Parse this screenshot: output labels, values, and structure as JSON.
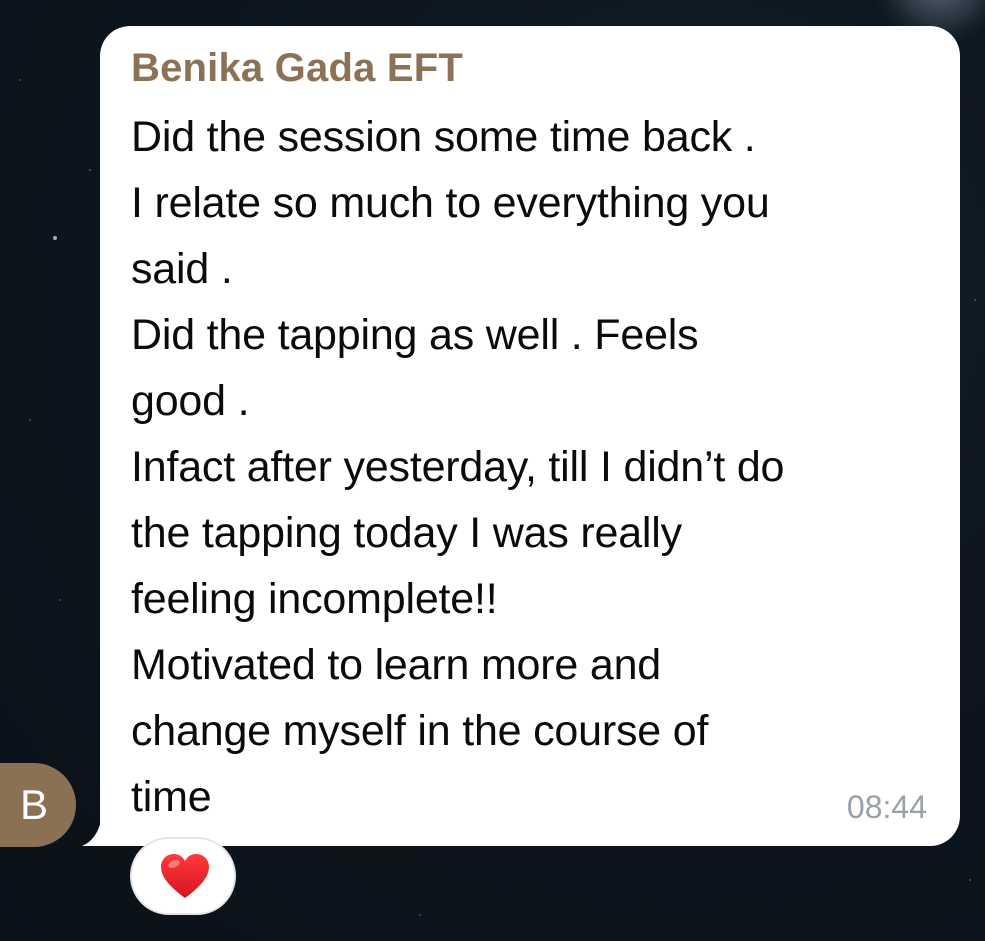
{
  "message": {
    "sender_name": "Benika Gada EFT",
    "lines": [
      "Did the session some time back .",
      "I relate so much to everything you",
      "said .",
      "Did the tapping as well . Feels",
      "good .",
      "Infact after yesterday, till I didn’t do",
      "the tapping today I was really",
      "feeling incomplete!!",
      "Motivated to learn more and",
      "change myself in the course of",
      "time"
    ],
    "time": "08:44",
    "reaction_icon": "heart-icon"
  },
  "avatar": {
    "initial": "B",
    "color": "#8a7154"
  },
  "colors": {
    "sender": "#8b7155",
    "bubble": "#ffffff",
    "timestamp": "#98a1a8",
    "reaction_heart": "#e8202a"
  }
}
